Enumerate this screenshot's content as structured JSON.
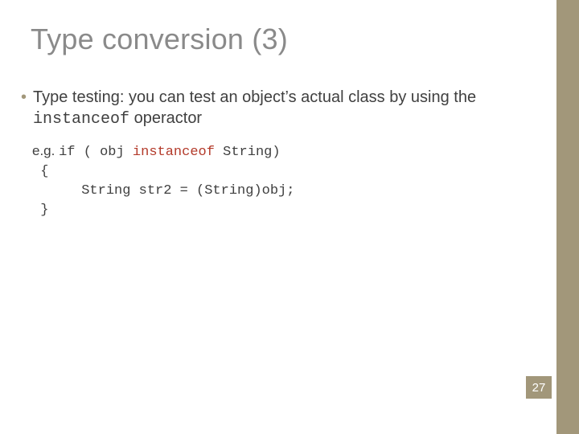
{
  "title": "Type conversion (3)",
  "bullet": {
    "pre": "Type testing: you can test an object’s actual class by using the ",
    "op": "instanceof",
    "post": " operactor"
  },
  "example": {
    "label": "e.g. ",
    "line1_a": "if ( obj ",
    "line1_kw": "instanceof",
    "line1_b": " String)",
    "line2": " {",
    "line3": "      String str2 = (String)obj;",
    "line4": " }"
  },
  "page": "27"
}
